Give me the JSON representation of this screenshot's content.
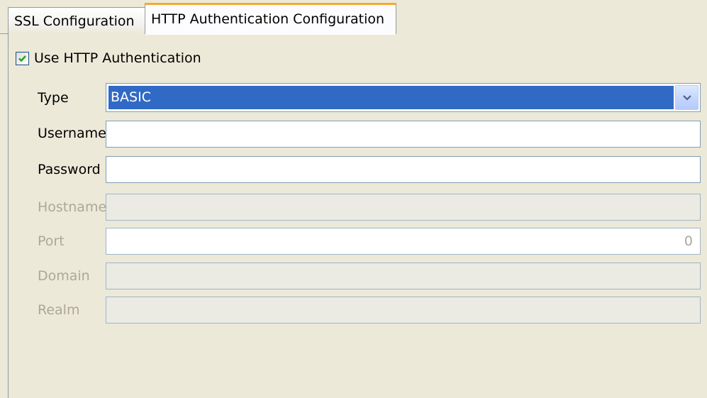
{
  "tabs": [
    {
      "label": "SSL Configuration",
      "active": false
    },
    {
      "label": "HTTP Authentication Configuration",
      "active": true
    }
  ],
  "use_http_auth": {
    "label": "Use HTTP Authentication",
    "checked": true
  },
  "form": {
    "type": {
      "label": "Type",
      "value": "BASIC"
    },
    "username": {
      "label": "Username",
      "value": ""
    },
    "password": {
      "label": "Password",
      "value": ""
    },
    "hostname": {
      "label": "Hostname",
      "value": ""
    },
    "port": {
      "label": "Port",
      "value": "0"
    },
    "domain": {
      "label": "Domain",
      "value": ""
    },
    "realm": {
      "label": "Realm",
      "value": ""
    }
  },
  "colors": {
    "background": "#ece9d8",
    "selection": "#316ac5",
    "active_tab_accent": "#f7a832",
    "checkmark": "#21a121",
    "disabled_text": "#aca899"
  },
  "icons": {
    "checkbox_mark": "check-icon",
    "dropdown": "chevron-down-icon"
  }
}
